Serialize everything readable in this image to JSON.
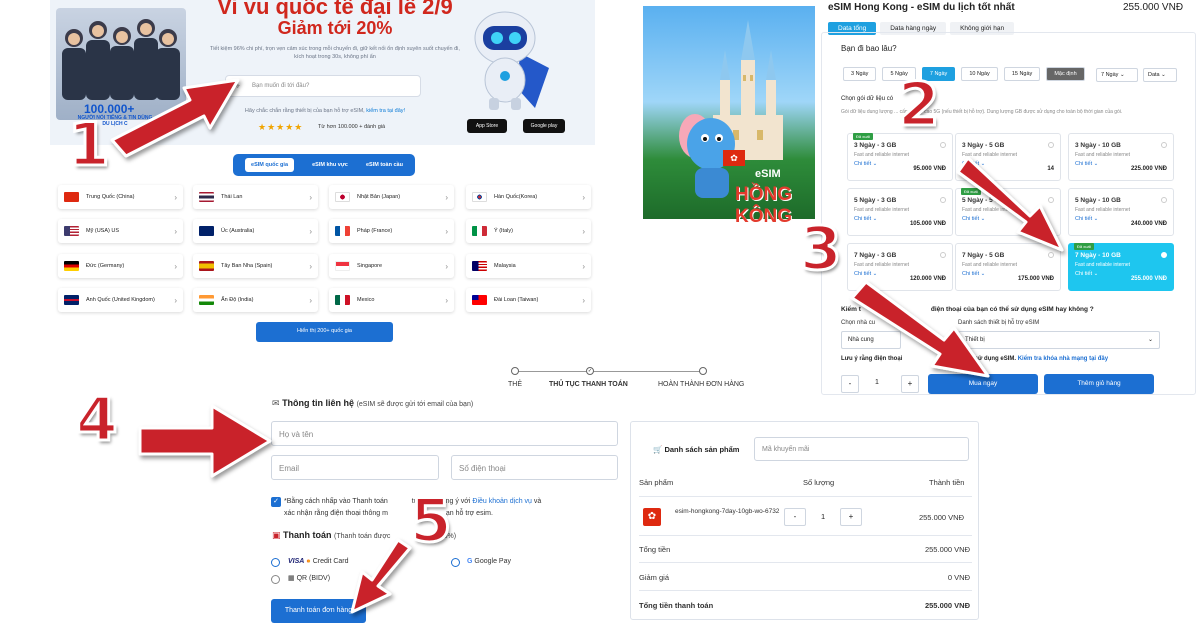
{
  "hero": {
    "title": "Vi vu quốc tế đại lễ 2/9",
    "subtitle": "Giảm tới 20%",
    "desc": "Tiết kiệm 96% chi phí, trọn vẹn cảm xúc trong mỗi chuyến đi, giữ kết nối ổn định xuyên suốt chuyến đi, kích hoạt trong 30s, không phí ẩn",
    "search_placeholder": "Bạn muốn đi tới đâu?",
    "hint": "Hãy chắc chắn rằng thiết bị của bạn hỗ trợ eSIM, ",
    "hint_link": "kiểm tra tại đây!",
    "stars": "★★★★★",
    "rating": "Từ hơn 100.000 + đánh giá",
    "badge": "100.000+",
    "badge_sub": "NGƯỜI NỔI TIẾNG & TIN DÙNG",
    "badge_sub2": "DU LỊCH C",
    "app_store": "App Store",
    "google_play": "Google play"
  },
  "tabs": [
    "eSIM quốc gia",
    "eSIM khu vực",
    "eSIM toàn cầu"
  ],
  "countries": [
    "Trung Quốc (China)",
    "Thái Lan",
    "Nhật Bản (Japan)",
    "Hàn Quốc(Korea)",
    "Mỹ (USA) US",
    "Úc (Australia)",
    "Pháp (France)",
    "Ý (Italy)",
    "Đức (Germany)",
    "Tây Ban Nha (Spain)",
    "Singapore",
    "Malaysia",
    "Anh Quốc (United Kingdom)",
    "Ấn Độ (India)",
    "Mexico",
    "Đài Loan (Taiwan)"
  ],
  "show_more": "Hiển thị 200+ quốc gia",
  "product": {
    "image_esim": "eSIM",
    "image_place": "HỒNG KÔNG",
    "title": "eSIM Hong Kong - eSIM du lịch tốt nhất",
    "price": "255.000 VNĐ",
    "tabs": [
      "Data tổng",
      "Data hàng ngày",
      "Không giới hạn"
    ],
    "question": "Bạn đi bao lâu?",
    "days": [
      "3 Ngày",
      "5 Ngày",
      "7 Ngày",
      "10 Ngày",
      "15 Ngày",
      "Mặc định"
    ],
    "day_select": "7 Ngày",
    "data_select": "Data",
    "choose_label": "Chọn gói dữ liệu có",
    "choose_desc": "Gói dữ liệu dung lượng ... cấp tốc độ cao 5G (nếu thiết bị hỗ trợ). Dung lượng GB được sử dụng cho toàn bộ thời gian của gói.",
    "plans": [
      {
        "title": "3 Ngày - 3 GB",
        "sub": "Fast and reliable internet",
        "detail": "Chi tiết",
        "price": "95.000 VNĐ",
        "badge": "Đã xuất"
      },
      {
        "title": "3 Ngày - 5 GB",
        "sub": "Fast and reliable internet",
        "detail": "Chi tiết",
        "price": "14",
        "badge": ""
      },
      {
        "title": "3 Ngày - 10 GB",
        "sub": "Fast and reliable internet",
        "detail": "Chi tiết",
        "price": "225.000 VNĐ",
        "badge": ""
      },
      {
        "title": "5 Ngày - 3 GB",
        "sub": "Fast and reliable internet",
        "detail": "Chi tiết",
        "price": "105.000 VNĐ",
        "badge": ""
      },
      {
        "title": "5 Ngày - 5 GB",
        "sub": "Fast and reliable internet",
        "detail": "Chi tiết",
        "price": "",
        "badge": "Đã xuất"
      },
      {
        "title": "5 Ngày - 10 GB",
        "sub": "Fast and reliable internet",
        "detail": "Chi tiết",
        "price": "240.000 VNĐ",
        "badge": ""
      },
      {
        "title": "7 Ngày - 3 GB",
        "sub": "Fast and reliable internet",
        "detail": "Chi tiết",
        "price": "120.000 VNĐ",
        "badge": ""
      },
      {
        "title": "7 Ngày - 5 GB",
        "sub": "Fast and reliable internet",
        "detail": "Chi tiết",
        "price": "175.000 VNĐ",
        "badge": ""
      },
      {
        "title": "7 Ngày - 10 GB",
        "sub": "Fast and reliable internet",
        "detail": "Chi tiết",
        "price": "255.000 VNĐ",
        "badge": "Đã xuất"
      }
    ],
    "check_title": "Kiểm t",
    "check_title2": "điện thoại của bạn có thể sử dụng eSIM hay không ?",
    "brand_label": "Chọn nhà cu",
    "brand_value": "Nhà cung",
    "device_label": "Danh sách thiết bị hỗ trợ eSIM",
    "device_value": "Thiết bị",
    "note": "Lưu ý rằng điện thoại",
    "note2": "khóa để sử dụng eSIM. ",
    "note_link": "Kiểm tra khóa nhà mạng tại đây",
    "qty": "1",
    "minus": "-",
    "plus": "+",
    "buy_now": "Mua ngay",
    "add_cart": "Thêm giỏ hàng"
  },
  "checkout": {
    "steps": [
      "THẺ",
      "THỦ TỤC THANH TOÁN",
      "HOÀN THÀNH ĐƠN HÀNG"
    ],
    "contact_title": "Thông tin liên hệ",
    "contact_note": "(eSIM sẽ được gửi tới email của bạn)",
    "name_placeholder": "Họ và tên",
    "email_placeholder": "Email",
    "phone_placeholder": "Số điện thoại",
    "terms_a": "*Bằng cách nhấp vào Thanh toán",
    "terms_b": " tự động đồng ý với ",
    "terms_link": "Điều khoản dịch vụ",
    "terms_c": " và",
    "terms_d": "xác nhận rằng điện thoại thông m",
    "terms_e": "ạn hỗ trợ esim.",
    "payment_title": "Thanh toán",
    "payment_note": "(Thanh toán được",
    "payment_note2": "s 100%)",
    "credit": "Credit Card",
    "gpay": "Google Pay",
    "qr": "QR (BIDV)",
    "pay_button": "Thanh toán đơn hàng"
  },
  "cart": {
    "title": "Danh sách sản phẩm",
    "promo_placeholder": "Mã khuyến mãi",
    "col_product": "Sản phẩm",
    "col_qty": "Số lượng",
    "col_total": "Thành tiền",
    "item_name": "esim-hongkong-7day-10gb-wo-6732",
    "item_qty": "1",
    "item_price": "255.000 VNĐ",
    "subtotal_label": "Tổng tiền",
    "subtotal": "255.000 VNĐ",
    "discount_label": "Giảm giá",
    "discount": "0 VNĐ",
    "total_label": "Tổng tiền thanh toán",
    "total": "255.000 VNĐ"
  },
  "annotations": [
    "1",
    "2",
    "3",
    "4",
    "5"
  ],
  "colors": {
    "primary": "#1c6fd2",
    "accent": "#d0271d",
    "arrow": "#c9232b",
    "selected": "#1ec6ef"
  }
}
